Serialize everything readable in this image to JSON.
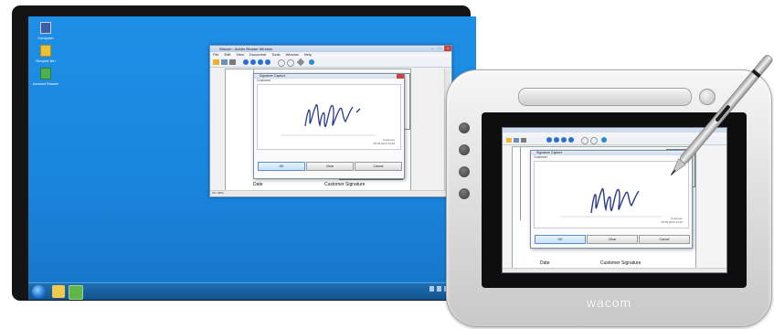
{
  "desktop": {
    "icons": [
      {
        "label": "Computer",
        "icon": "computer-icon"
      },
      {
        "label": "Recycle Bin",
        "icon": "recycle-bin-icon"
      },
      {
        "label": "Acrobat Reader",
        "icon": "app-shortcut-icon"
      }
    ]
  },
  "app_window": {
    "title": "Wacom - Adobe Reader Window",
    "menu": [
      "File",
      "Edit",
      "View",
      "Document",
      "Tools",
      "Window",
      "Help"
    ],
    "status": "OK 100%"
  },
  "signature_dialog": {
    "title": "Signature Capture",
    "subtitle": "Customer",
    "signer_name": "Customer",
    "timestamp": "09.09.2013 14:22",
    "buttons": [
      "OK",
      "Clear",
      "Cancel"
    ]
  },
  "document": {
    "date_label": "Date",
    "signature_label": "Customer Signature"
  },
  "tablet": {
    "brand": "wacom"
  },
  "colors": {
    "desktop_blue": "#1a84dc",
    "taskbar": "#11528e",
    "ink": "#2a3a8a"
  }
}
